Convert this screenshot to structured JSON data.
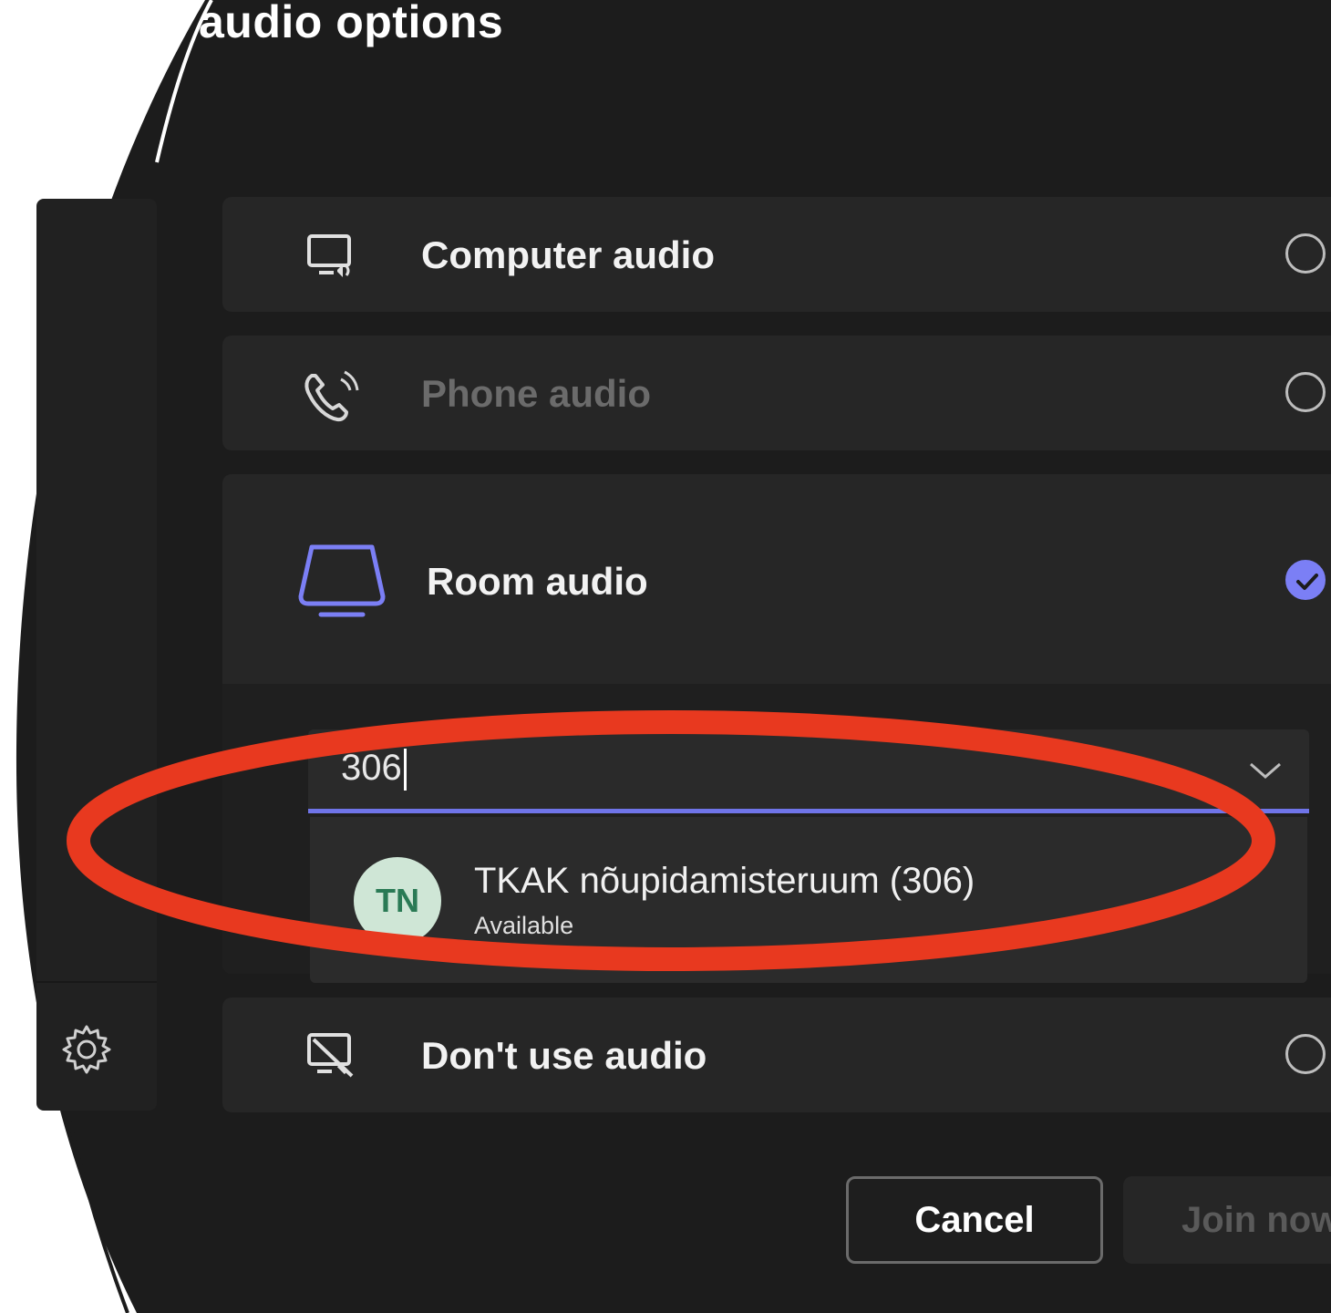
{
  "dialog": {
    "title": "audio options"
  },
  "options": {
    "computer_audio": {
      "label": "Computer audio",
      "selected": false
    },
    "phone_audio": {
      "label": "Phone audio",
      "selected": false,
      "disabled": true
    },
    "room_audio": {
      "label": "Room audio",
      "selected": true
    },
    "no_audio": {
      "label": "Don't use audio",
      "selected": false
    }
  },
  "room_search": {
    "value": "306",
    "suggestions": [
      {
        "initials": "TN",
        "name": "TKAK nõupidamisteruum (306)",
        "status": "Available"
      }
    ]
  },
  "buttons": {
    "cancel": "Cancel",
    "join": "Join now"
  },
  "colors": {
    "accent": "#7b7ff5",
    "annotation": "#e8391f",
    "background": "#1c1c1c",
    "card": "#262626",
    "avatar_bg": "#cfe6d6",
    "avatar_text": "#2a7a55"
  },
  "icons": {
    "computer_audio": "monitor-speaker-icon",
    "phone_audio": "phone-icon",
    "room_audio": "room-device-icon",
    "no_audio": "monitor-muted-icon",
    "settings": "gear-icon",
    "dropdown": "chevron-down-icon",
    "selected": "checkmark-icon"
  }
}
